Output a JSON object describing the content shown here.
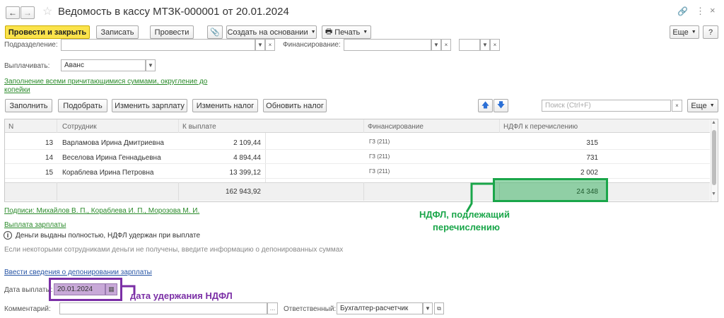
{
  "window": {
    "title": "Ведомость в кассу МТЗК-000001 от 20.01.2024",
    "link_icon": "link-icon",
    "menu_icon": "more-vertical-icon",
    "close_icon": "close-icon"
  },
  "toolbar": {
    "post_close": "Провести и закрыть",
    "save": "Записать",
    "post": "Провести",
    "create_based": "Создать на основании",
    "print": "Печать",
    "more": "Еще",
    "help": "?"
  },
  "form": {
    "department_label": "Подразделение:",
    "financing_label": "Финансирование:",
    "pay_label": "Выплачивать:",
    "pay_value": "Аванс",
    "fill_link": "Заполнение всеми причитающимися суммами, округление до копейки",
    "fill_link_line1": "Заполнение всеми причитающимися суммами, округление до",
    "fill_link_line2": "копейки"
  },
  "table_toolbar": {
    "fill": "Заполнить",
    "pick": "Подобрать",
    "change_salary": "Изменить зарплату",
    "change_tax": "Изменить налог",
    "refresh_tax": "Обновить налог",
    "search_placeholder": "Поиск (Ctrl+F)",
    "more": "Еще"
  },
  "table": {
    "columns": [
      "N",
      "Сотрудник",
      "К выплате",
      "Финансирование",
      "НДФЛ к перечислению"
    ],
    "rows": [
      {
        "n": "13",
        "employee": "Варламова Ирина Дмитриевна",
        "amount": "2 109,44",
        "financing": "ГЗ (211)",
        "tax": "315"
      },
      {
        "n": "14",
        "employee": "Веселова Ирина Геннадьевна",
        "amount": "4 894,44",
        "financing": "ГЗ (211)",
        "tax": "731"
      },
      {
        "n": "15",
        "employee": "Кораблева Ирина Петровна",
        "amount": "13 399,12",
        "financing": "ГЗ (211)",
        "tax": "2 002"
      }
    ],
    "footer_amount": "162 943,92",
    "footer_tax": "24 348"
  },
  "bottom": {
    "signatures": "Подписи: Михайлов В. П., Кораблева И. П., Морозова М. И.",
    "payout_link": "Выплата зарплаты",
    "info_text": "Деньги выданы полностью, НДФЛ удержан при выплате",
    "hint_text": "Если некоторыми сотрудниками деньги не получены, введите информацию о депонированных суммах",
    "deposit_link": "Ввести сведения о депонировании зарплаты",
    "date_label": "Дата выплаты:",
    "date_value": "20.01.2024",
    "comment_label": "Комментарий:",
    "responsible_label": "Ответственный:",
    "responsible_value": "Бухгалтер-расчетчик"
  },
  "annotations": {
    "tax_note_line1": "НДФЛ, подлежащий",
    "tax_note_line2": "перечислению",
    "date_note": "дата удержания НДФЛ",
    "green": "#1aa64a",
    "purple": "#7b2fa6"
  }
}
